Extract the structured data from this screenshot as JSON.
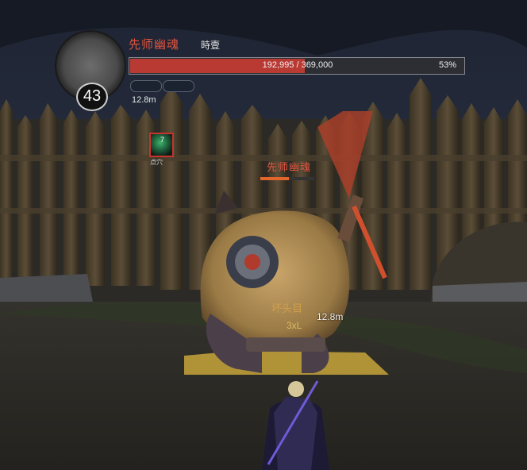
{
  "boss": {
    "level": "43",
    "name": "先师幽魂",
    "tag": "時壹",
    "hp_text": "192,995 / 369,000",
    "hp_percent_text": "53%",
    "hp_fraction": 0.523,
    "distance": "12.8m"
  },
  "buff": {
    "stack_count": "7",
    "label": "点穴"
  },
  "overhead": {
    "name": "先师幽魂",
    "hp_fraction": 0.53
  },
  "target": {
    "distance": "12.8m",
    "mark_text": "坏头目",
    "multiplier_text": "3xL"
  },
  "colors": {
    "boss_name": "#e0543f",
    "hp_fill": "#b93a33",
    "overhead_fill": "#e2662c",
    "buff_border": "#c8332c"
  }
}
